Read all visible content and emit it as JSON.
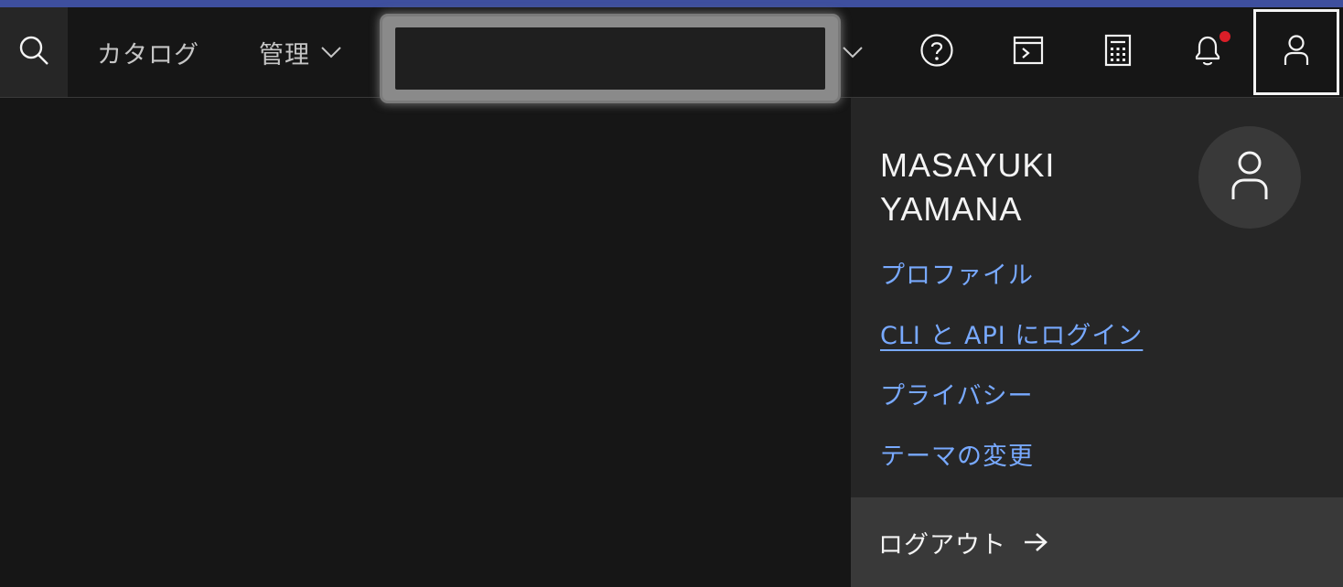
{
  "header": {
    "nav": {
      "catalog_label": "カタログ",
      "manage_label": "管理"
    },
    "account_switcher": {
      "redacted": true
    }
  },
  "icons": {
    "search": "search-icon",
    "help": "help-icon",
    "shell": "cloud-shell-icon",
    "calculator": "calculator-icon",
    "notifications": "notification-icon",
    "user": "user-icon"
  },
  "profile_menu": {
    "name_line1": "MASAYUKI",
    "name_line2": "YAMANA",
    "links": {
      "profile": "プロファイル",
      "cli_login": "CLI と API にログイン",
      "privacy": "プライバシー",
      "theme": "テーマの変更"
    },
    "logout_label": "ログアウト"
  },
  "colors": {
    "background": "#161616",
    "panel": "#262626",
    "link": "#78a9ff",
    "accent_bar": "#3e4f9e",
    "notification_dot": "#da1e28"
  }
}
